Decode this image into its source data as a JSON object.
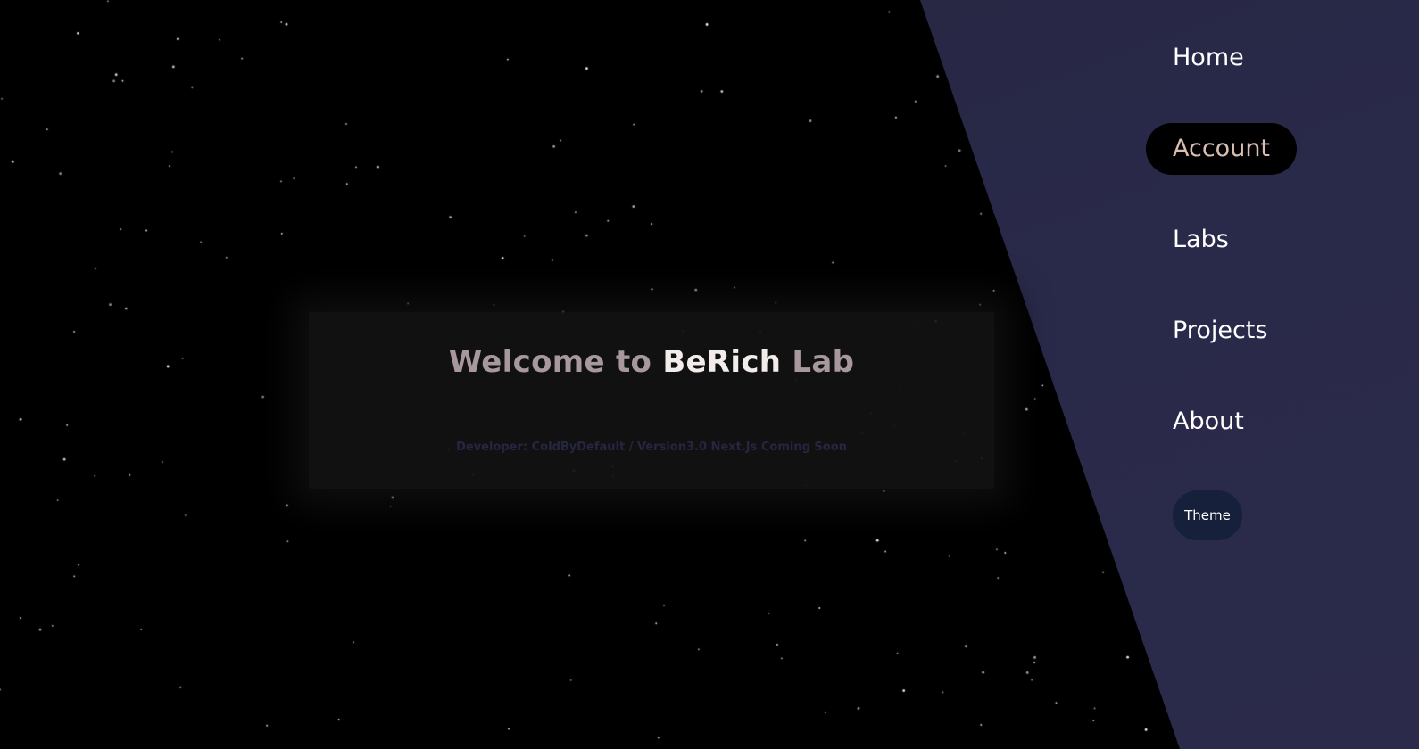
{
  "colors": {
    "background": "#000000",
    "nav_panel": "#28283f",
    "card": "#121212",
    "title_dim": "#a7989e",
    "title_brand": "#f2eceb",
    "subtitle": "#262642",
    "active_item_text": "#d9bfb2",
    "theme_button": "#16203a"
  },
  "hero": {
    "title_prefix": "Welcome to ",
    "title_brand": "BeRich",
    "title_suffix": " Lab",
    "subtitle": "Developer: ColdByDefault / Version3.0 Next.Js Coming Soon"
  },
  "nav": {
    "items": [
      {
        "label": "Home"
      },
      {
        "label": "Account",
        "active": true
      },
      {
        "label": "Labs"
      },
      {
        "label": "Projects"
      },
      {
        "label": "About"
      }
    ],
    "theme_label": "Theme"
  }
}
